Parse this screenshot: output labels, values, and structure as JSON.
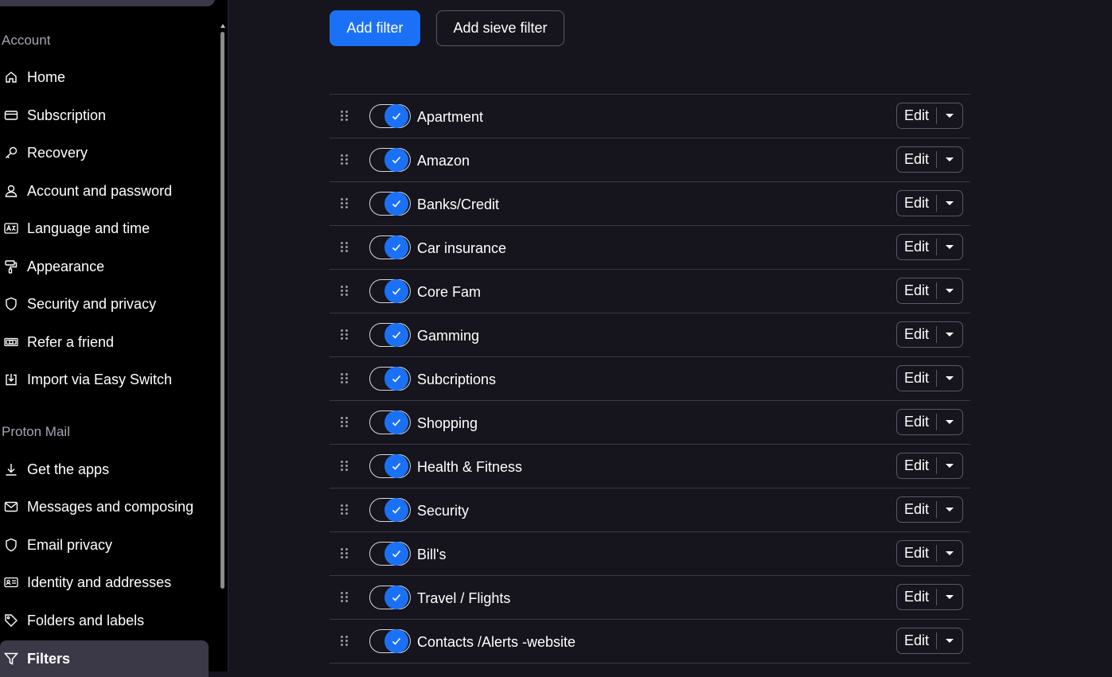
{
  "colors": {
    "accent": "#1b71f5",
    "sidebar_bg": "#000000",
    "main_bg": "#16141c",
    "active_item_bg": "#3b3947"
  },
  "sidebar": {
    "account_section": "Account",
    "account_items": [
      {
        "label": "Home",
        "icon": "home-icon"
      },
      {
        "label": "Subscription",
        "icon": "credit-card-icon"
      },
      {
        "label": "Recovery",
        "icon": "key-icon"
      },
      {
        "label": "Account and password",
        "icon": "user-icon"
      },
      {
        "label": "Language and time",
        "icon": "language-icon"
      },
      {
        "label": "Appearance",
        "icon": "paint-roller-icon"
      },
      {
        "label": "Security and privacy",
        "icon": "shield-icon"
      },
      {
        "label": "Refer a friend",
        "icon": "money-icon"
      },
      {
        "label": "Import via Easy Switch",
        "icon": "import-icon"
      }
    ],
    "mail_section": "Proton Mail",
    "mail_items": [
      {
        "label": "Get the apps",
        "icon": "download-icon"
      },
      {
        "label": "Messages and composing",
        "icon": "envelope-icon"
      },
      {
        "label": "Email privacy",
        "icon": "shield-icon"
      },
      {
        "label": "Identity and addresses",
        "icon": "id-card-icon"
      },
      {
        "label": "Folders and labels",
        "icon": "tag-icon"
      },
      {
        "label": "Filters",
        "icon": "filter-icon",
        "active": true
      }
    ]
  },
  "toolbar": {
    "add_filter": "Add filter",
    "add_sieve_filter": "Add sieve filter"
  },
  "filters": [
    {
      "name": "Apartment",
      "enabled": true,
      "edit": "Edit"
    },
    {
      "name": "Amazon",
      "enabled": true,
      "edit": "Edit"
    },
    {
      "name": "Banks/Credit",
      "enabled": true,
      "edit": "Edit"
    },
    {
      "name": "Car insurance",
      "enabled": true,
      "edit": "Edit"
    },
    {
      "name": "Core Fam",
      "enabled": true,
      "edit": "Edit"
    },
    {
      "name": "Gamming",
      "enabled": true,
      "edit": "Edit"
    },
    {
      "name": "Subcriptions",
      "enabled": true,
      "edit": "Edit"
    },
    {
      "name": "Shopping",
      "enabled": true,
      "edit": "Edit"
    },
    {
      "name": "Health & Fitness",
      "enabled": true,
      "edit": "Edit"
    },
    {
      "name": "Security",
      "enabled": true,
      "edit": "Edit"
    },
    {
      "name": "Bill's",
      "enabled": true,
      "edit": "Edit"
    },
    {
      "name": "Travel / Flights",
      "enabled": true,
      "edit": "Edit"
    },
    {
      "name": "Contacts /Alerts -website",
      "enabled": true,
      "edit": "Edit"
    }
  ]
}
